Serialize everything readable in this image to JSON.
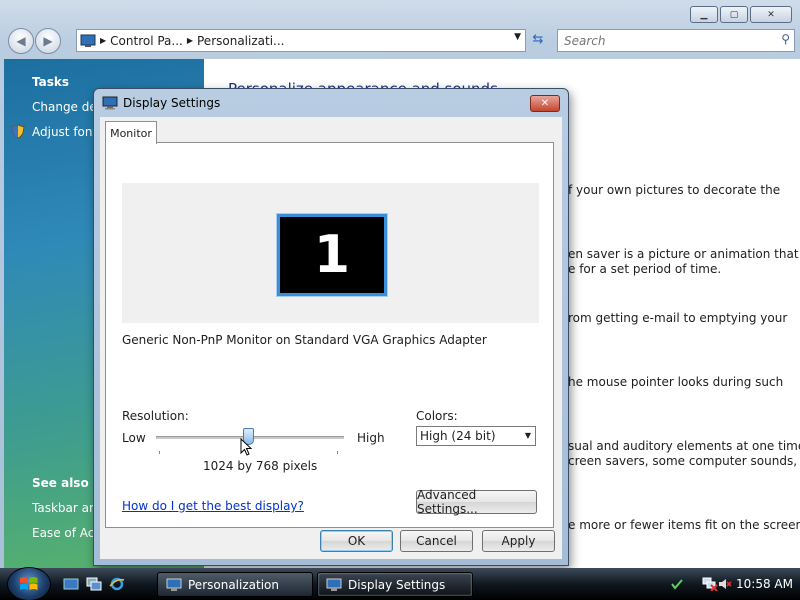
{
  "explorer": {
    "address_crumbs": [
      "Control Pa...",
      "Personalizati..."
    ],
    "search_placeholder": "Search",
    "left_pane": {
      "tasks_heading": "Tasks",
      "tasks": [
        "Change des",
        "Adjust font"
      ],
      "see_also_heading": "See also",
      "see_also": [
        "Taskbar and",
        "Ease of Acc"
      ]
    },
    "content_heading": "Personalize appearance and sounds",
    "content_lines": [
      "f your own pictures to decorate the",
      "en saver is a picture or animation that",
      "e for a set period of time.",
      "rom getting e-mail to emptying your",
      "he mouse pointer looks during such",
      "sual and auditory elements at one time",
      "creen savers, some computer sounds,",
      "e more or fewer items fit on the screen."
    ]
  },
  "dialog": {
    "title": "Display Settings",
    "tab": "Monitor",
    "monitor_number": "1",
    "monitor_name": "Generic Non-PnP Monitor on Standard VGA Graphics Adapter",
    "resolution_label": "Resolution:",
    "low_label": "Low",
    "high_label": "High",
    "resolution_value": "1024 by 768 pixels",
    "resolution_level": 0.5,
    "colors_label": "Colors:",
    "colors_value": "High (24 bit)",
    "help_link": "How do I get the best display?",
    "advanced_button": "Advanced Settings...",
    "ok_button": "OK",
    "cancel_button": "Cancel",
    "apply_button": "Apply"
  },
  "taskbar": {
    "tasks": [
      "Personalization",
      "Display Settings"
    ],
    "clock": "10:58 AM"
  }
}
